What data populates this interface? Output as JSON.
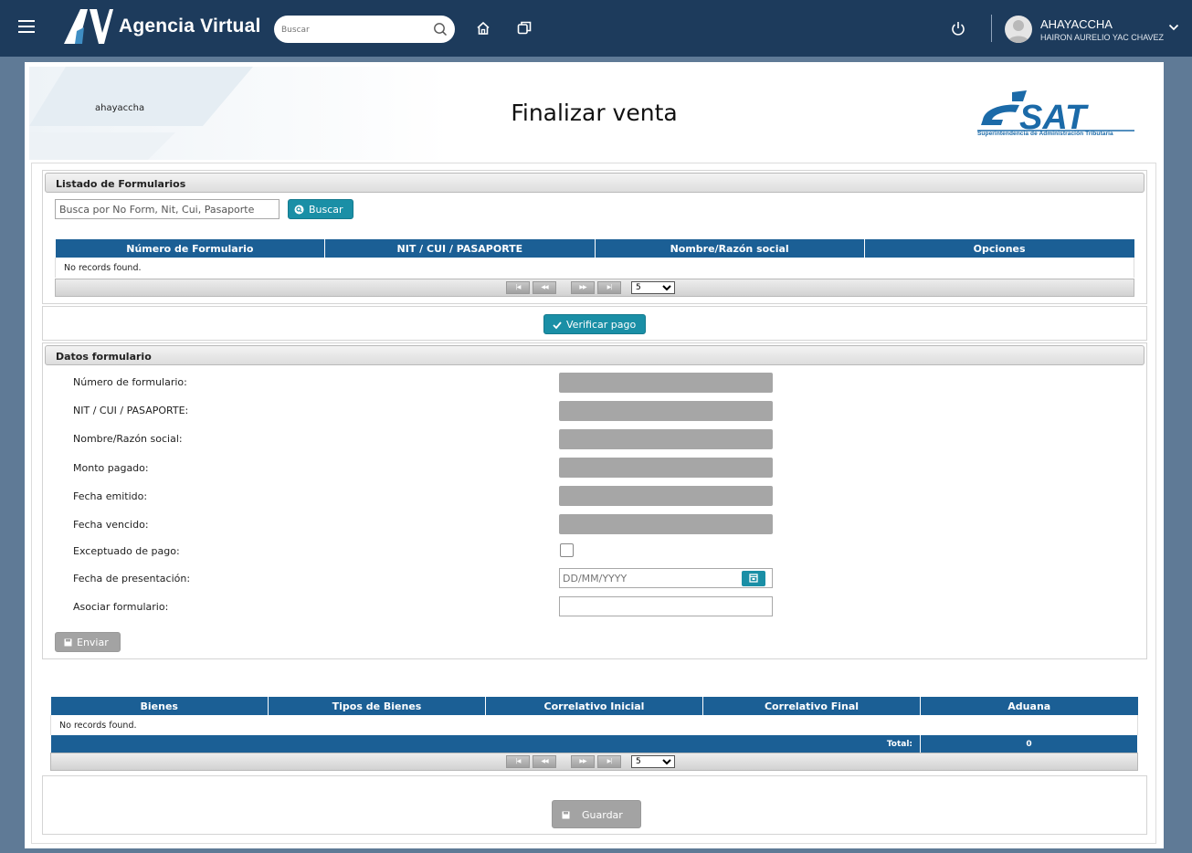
{
  "topbar": {
    "app_title": "Agencia Virtual",
    "search_placeholder": "Buscar",
    "username": "AHAYACCHA",
    "full_name": "HAIRON AURELIO YAC CHAVEZ"
  },
  "header": {
    "user_label": "ahayaccha",
    "page_title": "Finalizar venta",
    "logo_text": "SAT",
    "logo_subtitle": "Superintendencia de Administración Tributaria"
  },
  "listado": {
    "title": "Listado de Formularios",
    "search_placeholder": "Busca por No Form, Nit, Cui, Pasaporte",
    "search_button": "Buscar",
    "columns": [
      "Número de Formulario",
      "NIT / CUI / PASAPORTE",
      "Nombre/Razón social",
      "Opciones"
    ],
    "empty_message": "No records found.",
    "rows_per_page": "5"
  },
  "verificar_button": "Verificar pago",
  "datos": {
    "title": "Datos formulario",
    "labels": {
      "numero": "Número de formulario:",
      "nit": "NIT / CUI / PASAPORTE:",
      "nombre": "Nombre/Razón social:",
      "monto": "Monto pagado:",
      "emitido": "Fecha emitido:",
      "vencido": "Fecha vencido:",
      "exceptuado": "Exceptuado de pago:",
      "presentacion": "Fecha de presentación:",
      "asociar": "Asociar formulario:"
    },
    "date_placeholder": "DD/MM/YYYY",
    "enviar_button": "Enviar"
  },
  "bienes": {
    "columns": [
      "Bienes",
      "Tipos de Bienes",
      "Correlativo Inicial",
      "Correlativo Final",
      "Aduana"
    ],
    "empty_message": "No records found.",
    "total_label": "Total:",
    "total_value": "0",
    "rows_per_page": "5"
  },
  "guardar_button": "Guardar",
  "colors": {
    "topbar": "#1d3b5c",
    "table_header": "#1b5f95",
    "accent": "#1a8fa6",
    "disabled": "#a3a3a3"
  }
}
